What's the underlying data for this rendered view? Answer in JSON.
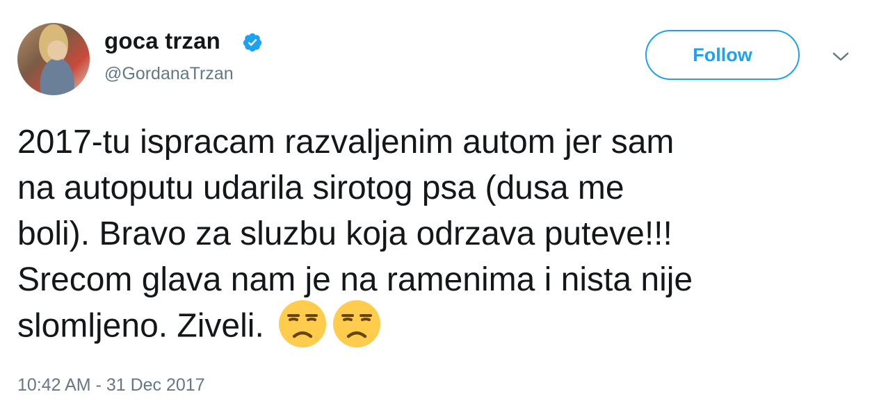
{
  "user": {
    "display_name": "goca trzan",
    "handle": "@GordanaTrzan",
    "verified": true
  },
  "actions": {
    "follow_label": "Follow",
    "menu_icon": "chevron-down-icon"
  },
  "tweet": {
    "lines": [
      "2017-tu ispracam razvaljenim autom jer sam",
      "na autoputu udarila sirotog psa (dusa me",
      "boli). Bravo za sluzbu koja odrzava puteve!!!",
      "Srecom glava nam je na ramenima i nista nije",
      "slomljeno. Ziveli."
    ],
    "emojis": [
      "unamused-face-emoji",
      "unamused-face-emoji"
    ],
    "timestamp": "10:42 AM - 31 Dec 2017"
  },
  "colors": {
    "accent": "#1da1f2",
    "text": "#14171a",
    "muted": "#657786",
    "emoji": "#ffcc4d"
  }
}
